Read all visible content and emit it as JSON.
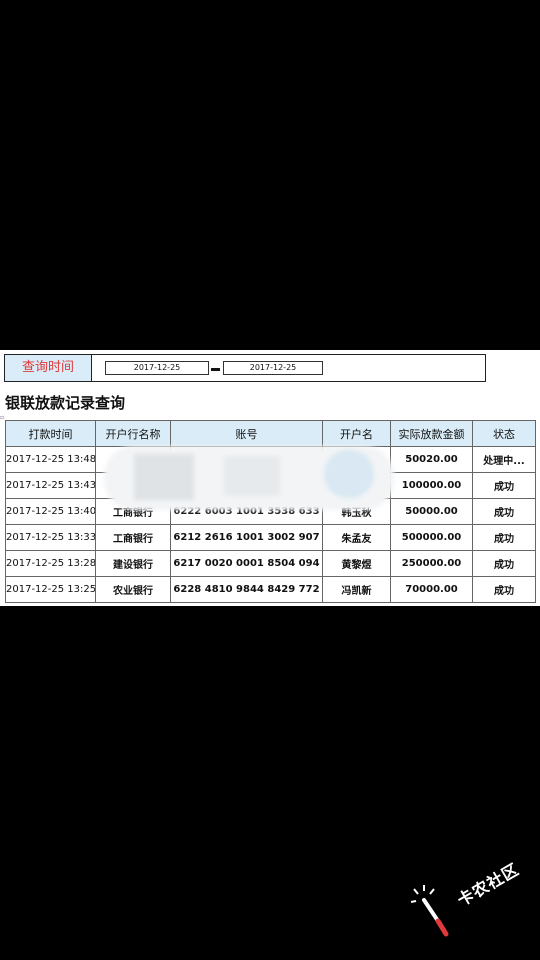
{
  "query": {
    "label": "查询时间",
    "start_date": "2017-12-25",
    "end_date": "2017-12-25"
  },
  "page_title": "银联放款记录查询",
  "table": {
    "headers": [
      "打款时间",
      "开户行名称",
      "账号",
      "开户名",
      "实际放款金额",
      "状态"
    ],
    "rows": [
      {
        "time": "2017-12-25 13:48",
        "bank": "",
        "account": "",
        "name": "",
        "amount": "50020.00",
        "status": "处理中..."
      },
      {
        "time": "2017-12-25 13:43",
        "bank": "",
        "account": "",
        "name": "",
        "amount": "100000.00",
        "status": "成功"
      },
      {
        "time": "2017-12-25 13:40",
        "bank": "工商银行",
        "account": "6222 6003 1001 3538 633",
        "name": "韩玉秋",
        "amount": "50000.00",
        "status": "成功"
      },
      {
        "time": "2017-12-25 13:33",
        "bank": "工商银行",
        "account": "6212 2616 1001 3002 907",
        "name": "朱孟友",
        "amount": "500000.00",
        "status": "成功"
      },
      {
        "time": "2017-12-25 13:28",
        "bank": "建设银行",
        "account": "6217 0020 0001 8504 094",
        "name": "黄黎煜",
        "amount": "250000.00",
        "status": "成功"
      },
      {
        "time": "2017-12-25 13:25",
        "bank": "农业银行",
        "account": "6228 4810 9844 8429 772",
        "name": "冯凯新",
        "amount": "70000.00",
        "status": "成功"
      }
    ]
  },
  "watermark": {
    "text": "卡农社区",
    "icon": "magic-wand-icon"
  },
  "colors": {
    "header_bg": "#d9ecf7",
    "label_red": "#e03a3a",
    "status_red": "#d12b2b"
  }
}
